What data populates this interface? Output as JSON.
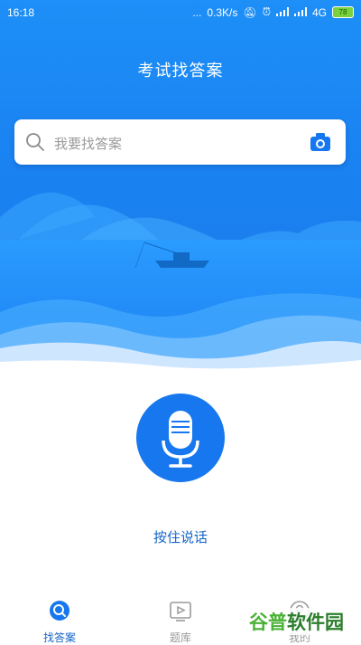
{
  "status_bar": {
    "time": "16:18",
    "dots": "...",
    "net_speed": "0.3K/s",
    "network": "4G",
    "battery": "78"
  },
  "header": {
    "title": "考试找答案"
  },
  "search": {
    "placeholder": "我要找答案",
    "search_icon": "search-icon",
    "camera_icon": "camera-icon"
  },
  "voice": {
    "mic_icon": "microphone-icon",
    "label": "按住说话"
  },
  "tabs": [
    {
      "label": "找答案",
      "icon": "search-tab-icon",
      "active": true
    },
    {
      "label": "题库",
      "icon": "play-board-icon",
      "active": false
    },
    {
      "label": "我的",
      "icon": "profile-icon",
      "active": false
    }
  ],
  "watermark": {
    "text": "谷普软件园"
  },
  "colors": {
    "primary": "#1677ee",
    "hero_top": "#1d8ff7",
    "label_blue": "#1564c7",
    "inactive": "#9a9a9a",
    "battery_green": "#7bd13b"
  }
}
